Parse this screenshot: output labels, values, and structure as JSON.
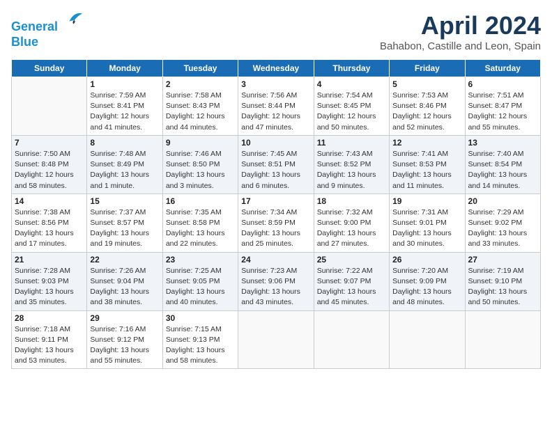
{
  "header": {
    "logo_line1": "General",
    "logo_line2": "Blue",
    "title": "April 2024",
    "subtitle": "Bahabon, Castille and Leon, Spain"
  },
  "weekdays": [
    "Sunday",
    "Monday",
    "Tuesday",
    "Wednesday",
    "Thursday",
    "Friday",
    "Saturday"
  ],
  "weeks": [
    [
      {
        "day": "",
        "info": ""
      },
      {
        "day": "1",
        "info": "Sunrise: 7:59 AM\nSunset: 8:41 PM\nDaylight: 12 hours\nand 41 minutes."
      },
      {
        "day": "2",
        "info": "Sunrise: 7:58 AM\nSunset: 8:43 PM\nDaylight: 12 hours\nand 44 minutes."
      },
      {
        "day": "3",
        "info": "Sunrise: 7:56 AM\nSunset: 8:44 PM\nDaylight: 12 hours\nand 47 minutes."
      },
      {
        "day": "4",
        "info": "Sunrise: 7:54 AM\nSunset: 8:45 PM\nDaylight: 12 hours\nand 50 minutes."
      },
      {
        "day": "5",
        "info": "Sunrise: 7:53 AM\nSunset: 8:46 PM\nDaylight: 12 hours\nand 52 minutes."
      },
      {
        "day": "6",
        "info": "Sunrise: 7:51 AM\nSunset: 8:47 PM\nDaylight: 12 hours\nand 55 minutes."
      }
    ],
    [
      {
        "day": "7",
        "info": "Sunrise: 7:50 AM\nSunset: 8:48 PM\nDaylight: 12 hours\nand 58 minutes."
      },
      {
        "day": "8",
        "info": "Sunrise: 7:48 AM\nSunset: 8:49 PM\nDaylight: 13 hours\nand 1 minute."
      },
      {
        "day": "9",
        "info": "Sunrise: 7:46 AM\nSunset: 8:50 PM\nDaylight: 13 hours\nand 3 minutes."
      },
      {
        "day": "10",
        "info": "Sunrise: 7:45 AM\nSunset: 8:51 PM\nDaylight: 13 hours\nand 6 minutes."
      },
      {
        "day": "11",
        "info": "Sunrise: 7:43 AM\nSunset: 8:52 PM\nDaylight: 13 hours\nand 9 minutes."
      },
      {
        "day": "12",
        "info": "Sunrise: 7:41 AM\nSunset: 8:53 PM\nDaylight: 13 hours\nand 11 minutes."
      },
      {
        "day": "13",
        "info": "Sunrise: 7:40 AM\nSunset: 8:54 PM\nDaylight: 13 hours\nand 14 minutes."
      }
    ],
    [
      {
        "day": "14",
        "info": "Sunrise: 7:38 AM\nSunset: 8:56 PM\nDaylight: 13 hours\nand 17 minutes."
      },
      {
        "day": "15",
        "info": "Sunrise: 7:37 AM\nSunset: 8:57 PM\nDaylight: 13 hours\nand 19 minutes."
      },
      {
        "day": "16",
        "info": "Sunrise: 7:35 AM\nSunset: 8:58 PM\nDaylight: 13 hours\nand 22 minutes."
      },
      {
        "day": "17",
        "info": "Sunrise: 7:34 AM\nSunset: 8:59 PM\nDaylight: 13 hours\nand 25 minutes."
      },
      {
        "day": "18",
        "info": "Sunrise: 7:32 AM\nSunset: 9:00 PM\nDaylight: 13 hours\nand 27 minutes."
      },
      {
        "day": "19",
        "info": "Sunrise: 7:31 AM\nSunset: 9:01 PM\nDaylight: 13 hours\nand 30 minutes."
      },
      {
        "day": "20",
        "info": "Sunrise: 7:29 AM\nSunset: 9:02 PM\nDaylight: 13 hours\nand 33 minutes."
      }
    ],
    [
      {
        "day": "21",
        "info": "Sunrise: 7:28 AM\nSunset: 9:03 PM\nDaylight: 13 hours\nand 35 minutes."
      },
      {
        "day": "22",
        "info": "Sunrise: 7:26 AM\nSunset: 9:04 PM\nDaylight: 13 hours\nand 38 minutes."
      },
      {
        "day": "23",
        "info": "Sunrise: 7:25 AM\nSunset: 9:05 PM\nDaylight: 13 hours\nand 40 minutes."
      },
      {
        "day": "24",
        "info": "Sunrise: 7:23 AM\nSunset: 9:06 PM\nDaylight: 13 hours\nand 43 minutes."
      },
      {
        "day": "25",
        "info": "Sunrise: 7:22 AM\nSunset: 9:07 PM\nDaylight: 13 hours\nand 45 minutes."
      },
      {
        "day": "26",
        "info": "Sunrise: 7:20 AM\nSunset: 9:09 PM\nDaylight: 13 hours\nand 48 minutes."
      },
      {
        "day": "27",
        "info": "Sunrise: 7:19 AM\nSunset: 9:10 PM\nDaylight: 13 hours\nand 50 minutes."
      }
    ],
    [
      {
        "day": "28",
        "info": "Sunrise: 7:18 AM\nSunset: 9:11 PM\nDaylight: 13 hours\nand 53 minutes."
      },
      {
        "day": "29",
        "info": "Sunrise: 7:16 AM\nSunset: 9:12 PM\nDaylight: 13 hours\nand 55 minutes."
      },
      {
        "day": "30",
        "info": "Sunrise: 7:15 AM\nSunset: 9:13 PM\nDaylight: 13 hours\nand 58 minutes."
      },
      {
        "day": "",
        "info": ""
      },
      {
        "day": "",
        "info": ""
      },
      {
        "day": "",
        "info": ""
      },
      {
        "day": "",
        "info": ""
      }
    ]
  ]
}
